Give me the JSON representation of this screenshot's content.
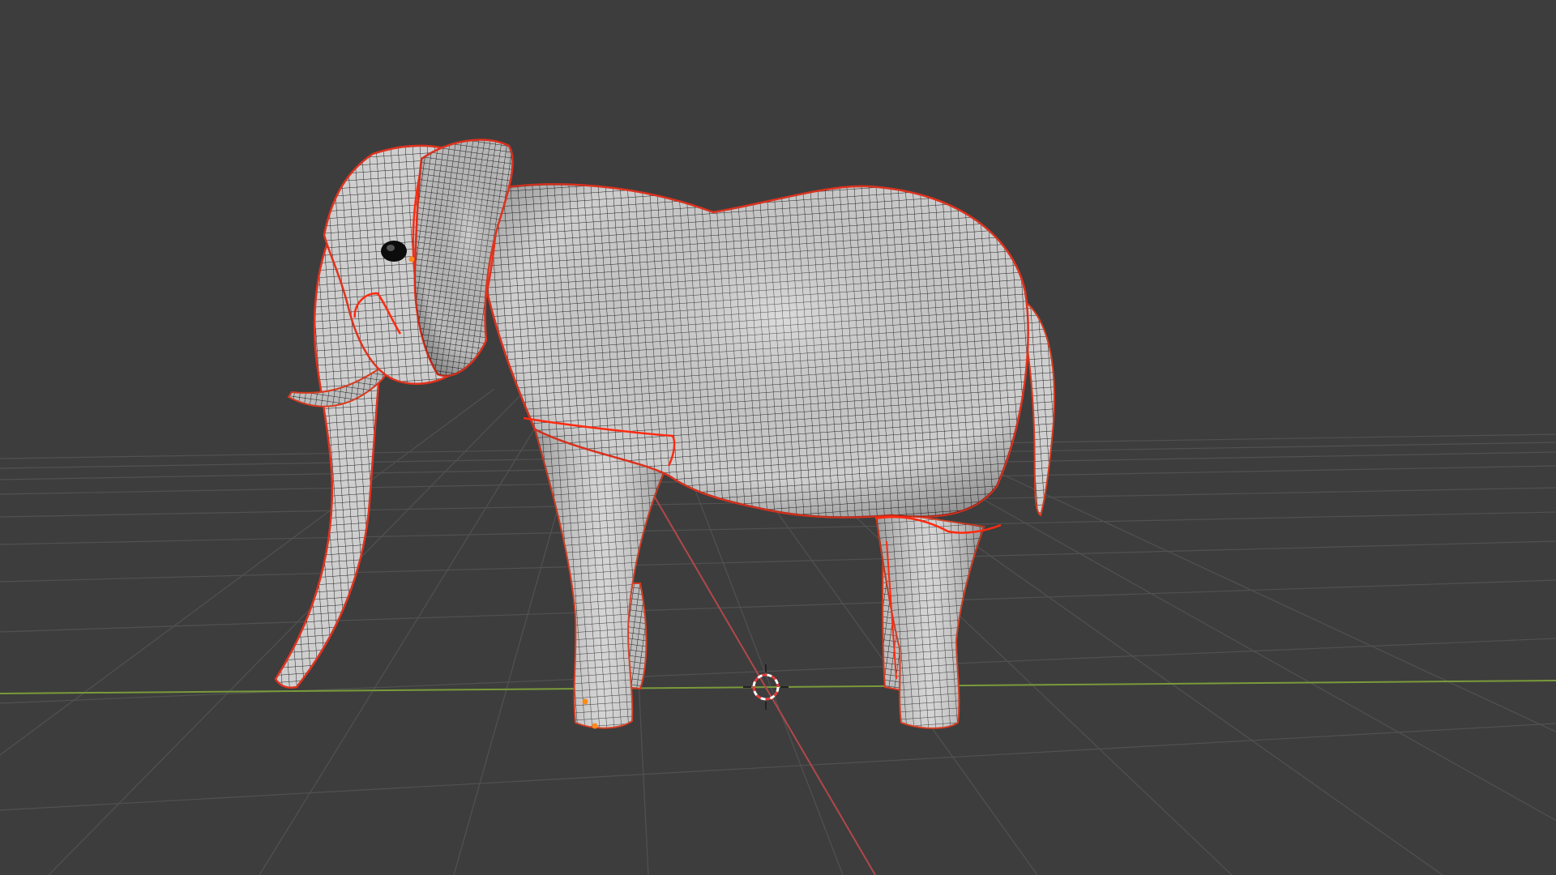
{
  "viewport": {
    "name": "3D Viewport",
    "background": "#3d3d3d",
    "grid_color": "#555555",
    "x_axis_color": "#c0484a",
    "y_axis_color": "#7a9a3a"
  },
  "model": {
    "name": "elephant-mesh",
    "surface_color": "#c9c9c9",
    "wire_color": "#1e1e1e",
    "selection_outline_color": "#e0321e",
    "seam_color": "#ff3a1a",
    "selected_vertex_color": "#ff8a1a"
  },
  "cursor": {
    "icon": "3d-cursor-icon",
    "ring_color": "#e83a3a",
    "ring_alt_color": "#ffffff"
  }
}
